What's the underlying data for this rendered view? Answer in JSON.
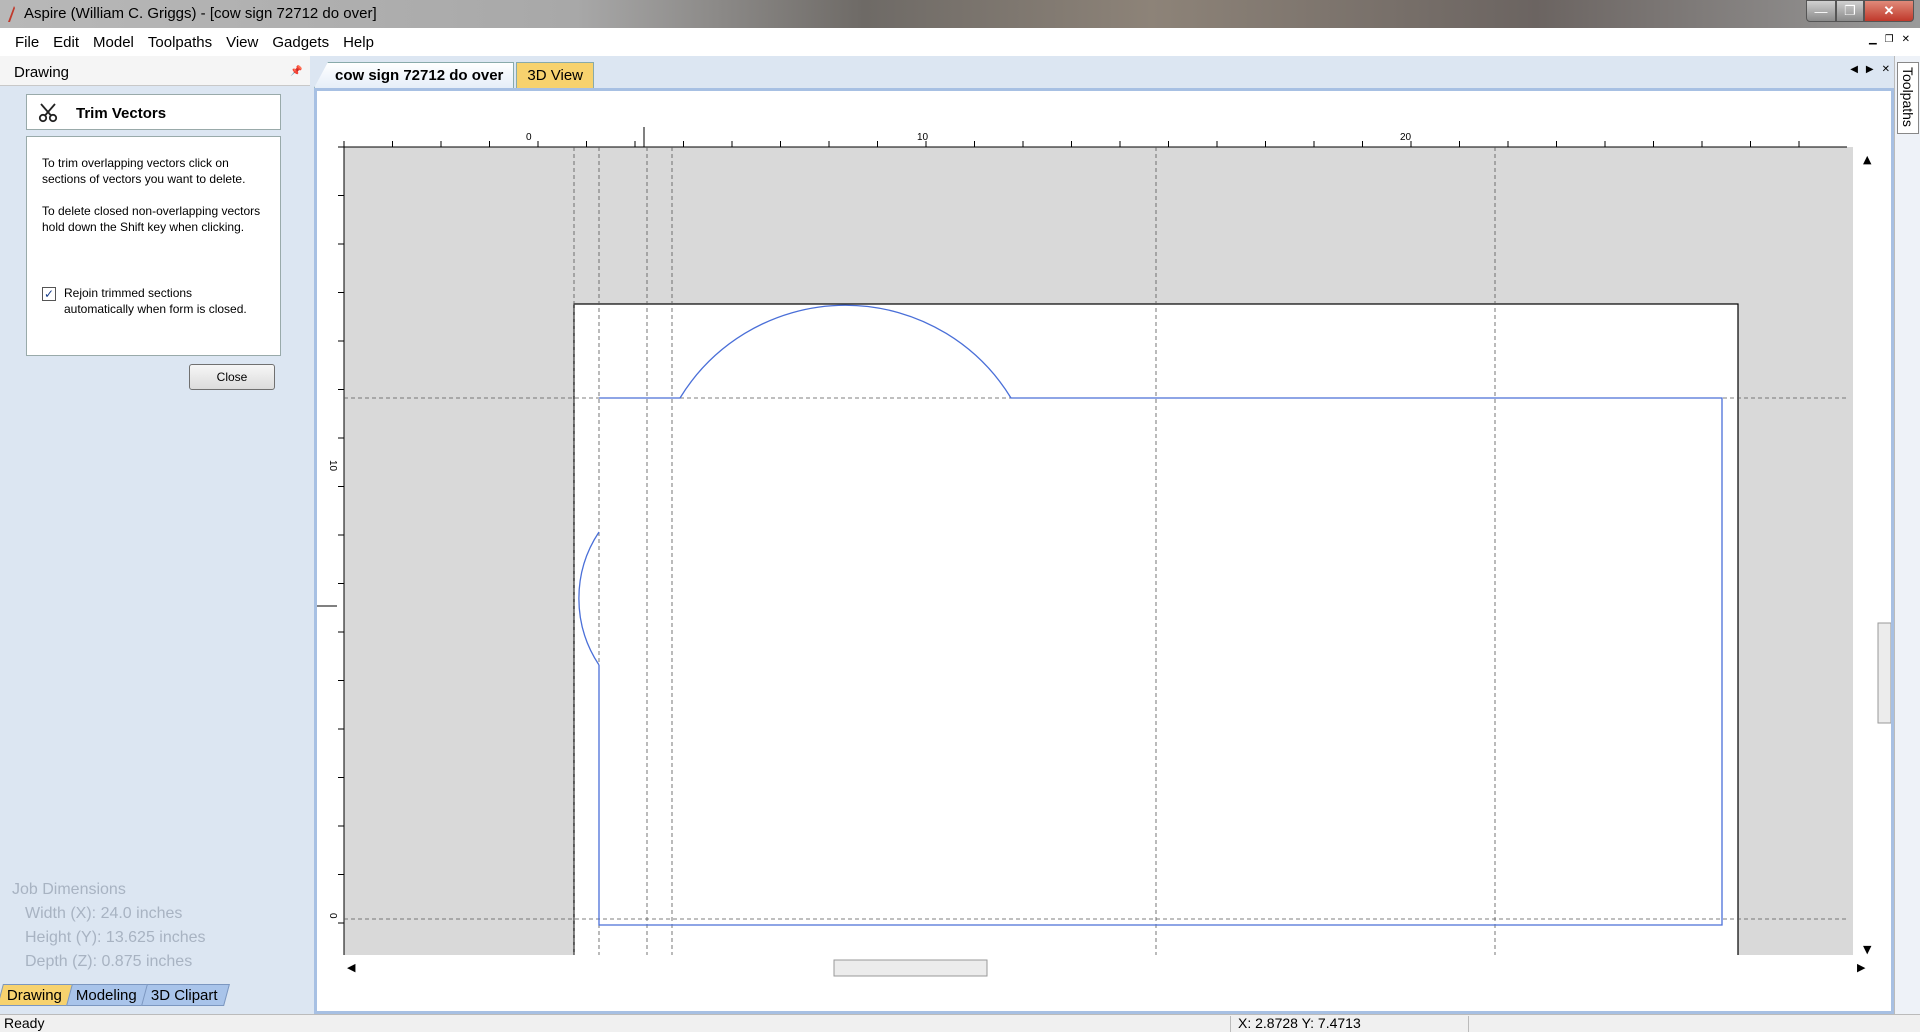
{
  "window": {
    "title": "Aspire (William C. Griggs) - [cow sign 72712 do over]",
    "controls": {
      "minimize": "—",
      "maximize": "❐",
      "close": "✕"
    }
  },
  "menu": [
    "File",
    "Edit",
    "Model",
    "Toolpaths",
    "View",
    "Gadgets",
    "Help"
  ],
  "left_panel": {
    "title": "Drawing",
    "tool_title": "Trim Vectors",
    "instruction_1": "To trim overlapping vectors click on sections of vectors you want to delete.",
    "instruction_2": "To delete closed non-overlapping vectors hold down the Shift key when clicking.",
    "rejoin_label": "Rejoin trimmed sections automatically when form is closed.",
    "rejoin_checked": true,
    "close_label": "Close",
    "job_dimensions": {
      "heading": "Job Dimensions",
      "width": "Width  (X): 24.0 inches",
      "height": "Height (Y): 13.625 inches",
      "depth": "Depth  (Z): 0.875 inches"
    },
    "bottom_tabs": [
      "Drawing",
      "Modeling",
      "3D Clipart"
    ]
  },
  "document": {
    "tabs": [
      "cow sign 72712 do over",
      "3D View"
    ],
    "ruler_h_labels": [
      "0",
      "10",
      "20"
    ],
    "ruler_v_labels": [
      "10",
      "0"
    ]
  },
  "right_tab": "Toolpaths",
  "status": {
    "text": "Ready",
    "coords": "X:  2.8728 Y:  7.4713"
  },
  "colors": {
    "vector": "#4a6fd8",
    "panel_bg": "#dce6f2",
    "tab_active": "#f7d26e",
    "tab_inactive": "#a9c4ea"
  }
}
